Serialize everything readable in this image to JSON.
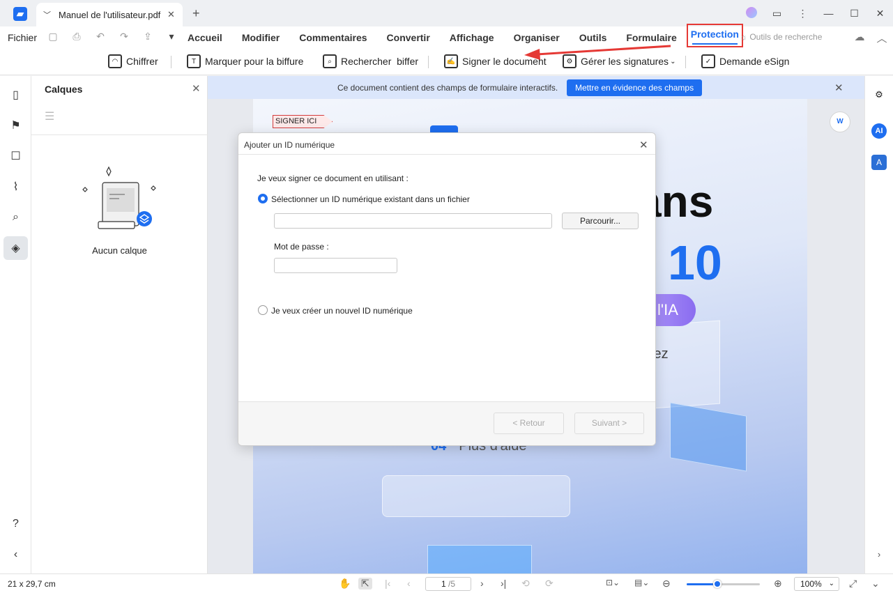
{
  "window": {
    "tab_title": "Manuel de l'utilisateur.pdf"
  },
  "menubar": {
    "file": "Fichier",
    "tabs": [
      "Accueil",
      "Modifier",
      "Commentaires",
      "Convertir",
      "Affichage",
      "Organiser",
      "Outils",
      "Formulaire",
      "Protection"
    ],
    "active_tab": "Protection",
    "search_tools": "Outils de recherche"
  },
  "toolbar": {
    "encrypt": "Chiffrer",
    "mark_redaction": "Marquer pour la biffure",
    "search_redact": "Rechercher  biffer",
    "sign_document": "Signer le document",
    "manage_signatures": "Gérer les signatures",
    "esign_request": "Demande eSign"
  },
  "layers_panel": {
    "title": "Calques",
    "empty_text": "Aucun calque"
  },
  "document": {
    "infobar_text": "Ce document contient des champs de formulaire interactifs.",
    "infobar_button": "Mettre en évidence des champs",
    "sign_here": "SIGNER ICI",
    "heading_fragment": "ans",
    "version_fragment": "10",
    "ai_fragment": "l'IA",
    "sub_fragment": "lez",
    "section_number": "04",
    "section_title": "Plus d'aide"
  },
  "right_rail": {
    "ai_label": "AI"
  },
  "dialog": {
    "title": "Ajouter un ID numérique",
    "intro": "Je veux signer ce document en utilisant :",
    "option_existing": "Sélectionner un ID numérique existant dans un fichier",
    "option_existing_selected": true,
    "file_path": "",
    "browse": "Parcourir...",
    "password_label": "Mot de passe :",
    "password": "",
    "option_new": "Je veux créer un nouvel ID numérique",
    "back": "< Retour",
    "next": "Suivant >"
  },
  "statusbar": {
    "page_size": "21 x 29,7 cm",
    "page_current": "1",
    "page_total": "/5",
    "zoom": "100%",
    "zoom_fraction": 0.42
  },
  "colors": {
    "accent": "#1e6ef0",
    "highlight_border": "#e53935"
  }
}
